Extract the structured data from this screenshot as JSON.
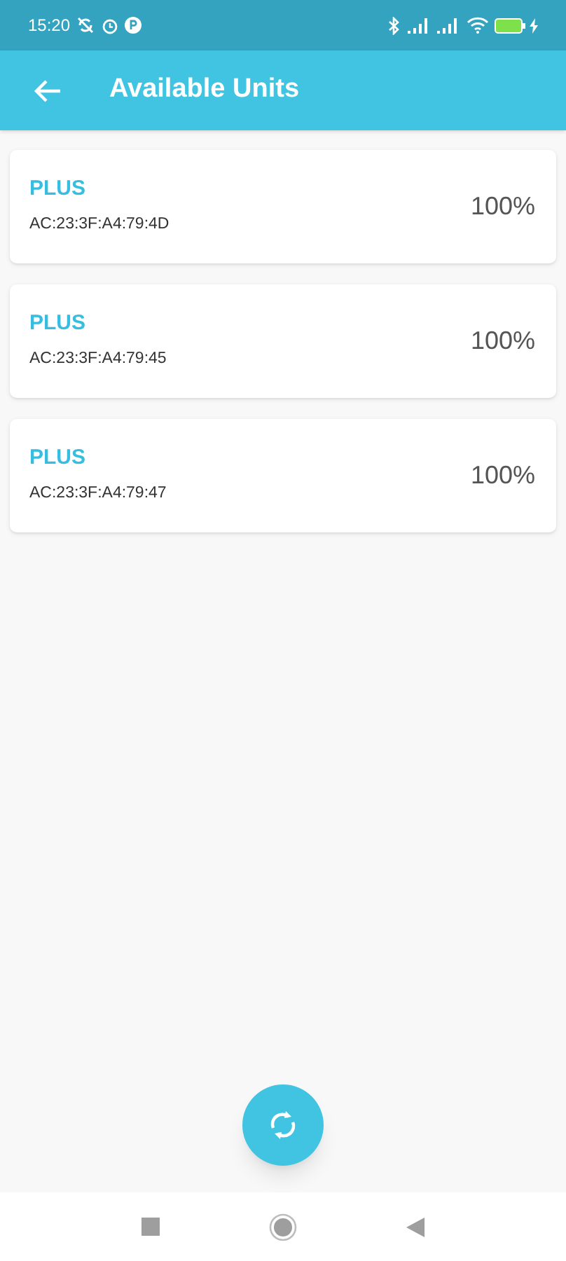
{
  "status_bar": {
    "time": "15:20"
  },
  "app_bar": {
    "title": "Available Units"
  },
  "units": [
    {
      "name": "PLUS",
      "address": "AC:23:3F:A4:79:4D",
      "battery": "100%"
    },
    {
      "name": "PLUS",
      "address": "AC:23:3F:A4:79:45",
      "battery": "100%"
    },
    {
      "name": "PLUS",
      "address": "AC:23:3F:A4:79:47",
      "battery": "100%"
    }
  ]
}
